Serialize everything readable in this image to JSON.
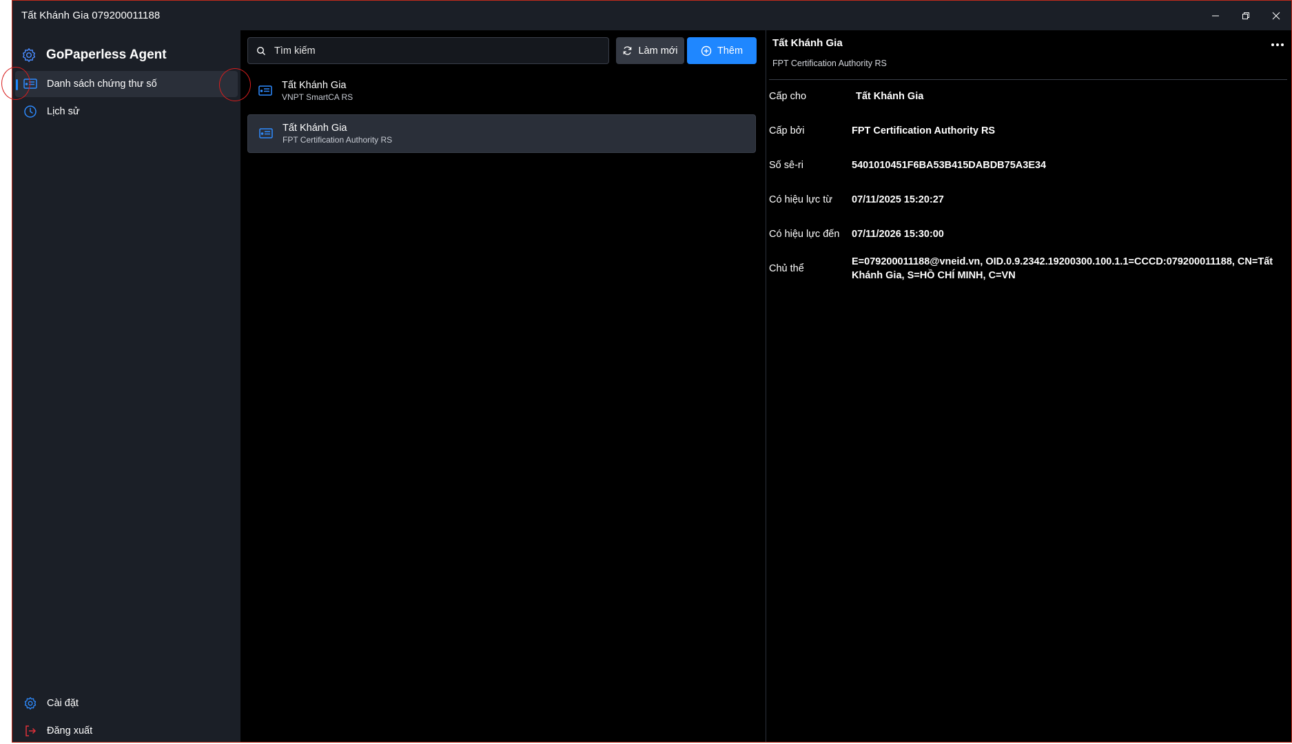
{
  "window": {
    "title": "Tất Khánh Gia 079200011188",
    "accent_color": "#1f87ff",
    "border_color": "#c42b1c"
  },
  "sidebar": {
    "brand": "GoPaperless Agent",
    "items": [
      {
        "label": "Danh sách chứng thư số",
        "icon": "certificate-icon",
        "active": true
      },
      {
        "label": "Lịch sử",
        "icon": "clock-icon",
        "active": false
      }
    ],
    "bottom_items": [
      {
        "label": "Cài đặt",
        "icon": "gear-icon"
      },
      {
        "label": "Đăng xuất",
        "icon": "logout-icon"
      }
    ]
  },
  "toolbar": {
    "search_placeholder": "Tìm kiếm",
    "refresh_label": "Làm mới",
    "add_label": "Thêm"
  },
  "certificates": [
    {
      "name": "Tất Khánh Gia",
      "issuer": "VNPT SmartCA RS",
      "selected": false
    },
    {
      "name": "Tất Khánh Gia",
      "issuer": "FPT Certification Authority RS",
      "selected": true
    }
  ],
  "detail": {
    "title": "Tất Khánh Gia",
    "subtitle": "FPT Certification Authority RS",
    "fields": [
      {
        "label": "Cấp cho",
        "value": "Tất Khánh Gia"
      },
      {
        "label": "Cấp bởi",
        "value": "FPT Certification Authority RS"
      },
      {
        "label": "Số sê-ri",
        "value": "5401010451F6BA53B415DABDB75A3E34"
      },
      {
        "label": "Có hiệu lực từ",
        "value": "07/11/2025 15:20:27"
      },
      {
        "label": "Có hiệu lực đến",
        "value": "07/11/2026 15:30:00"
      },
      {
        "label": "Chủ thể",
        "value": "E=079200011188@vneid.vn, OID.0.9.2342.19200300.100.1.1=CCCD:079200011188, CN=Tất Khánh Gia, S=HỒ CHÍ MINH, C=VN"
      }
    ]
  }
}
